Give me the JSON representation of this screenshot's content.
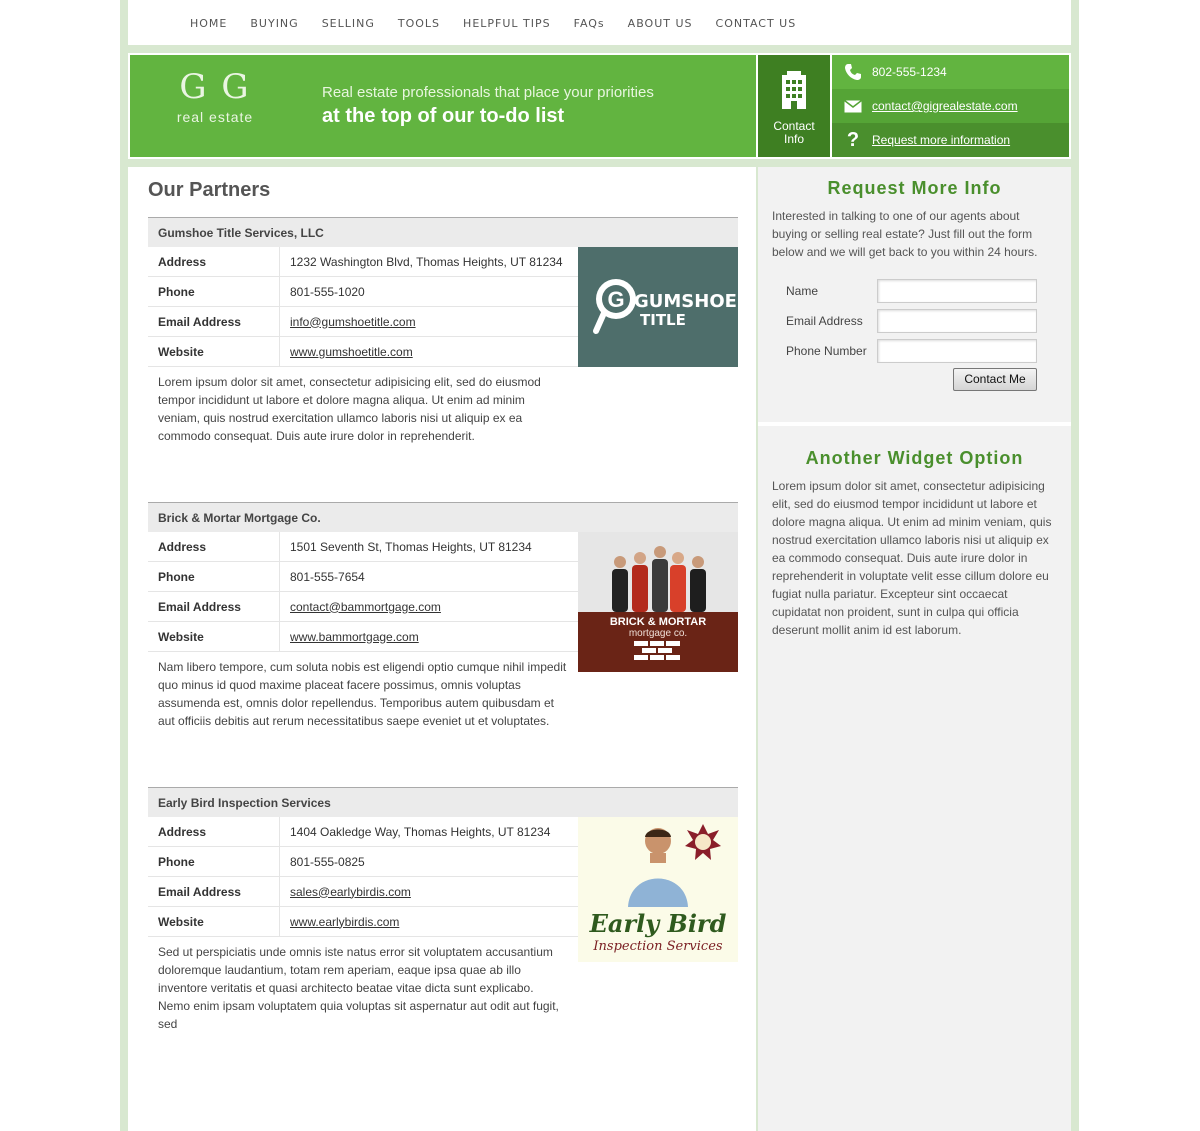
{
  "nav": {
    "items": [
      "HOME",
      "BUYING",
      "SELLING",
      "TOOLS",
      "HELPFUL TIPS",
      "FAQs",
      "ABOUT US",
      "CONTACT US"
    ]
  },
  "banner": {
    "logo_mark": "G G",
    "logo_sub": "real estate",
    "tagline_line1": "Real estate professionals that place your priorities",
    "tagline_line2": "at the top of our to-do list",
    "contact_tile_label": "Contact Info",
    "phone": "802-555-1234",
    "email": "contact@gigrealestate.com",
    "request": "Request more information",
    "colors": {
      "green": "#62b440",
      "dark_green": "#3e7f22"
    }
  },
  "main": {
    "title": "Our Partners",
    "field_labels": {
      "address": "Address",
      "phone": "Phone",
      "email": "Email Address",
      "website": "Website"
    },
    "partners": [
      {
        "name": "Gumshoe Title Services, LLC",
        "address": "1232 Washington Blvd, Thomas Heights, UT 81234",
        "phone": "801-555-1020",
        "email": "info@gumshoetitle.com",
        "website": "www.gumshoetitle.com",
        "description": "Lorem ipsum dolor sit amet, consectetur adipisicing elit, sed do eiusmod tempor incididunt ut labore et dolore magna aliqua. Ut enim ad minim veniam, quis nostrud exercitation ullamco laboris nisi ut aliquip ex ea commodo consequat. Duis aute irure dolor in reprehenderit.",
        "logo_text_1": "GUMSHOE",
        "logo_text_2": "TITLE"
      },
      {
        "name": "Brick & Mortar Mortgage Co.",
        "address": "1501 Seventh St, Thomas Heights, UT 81234",
        "phone": "801-555-7654",
        "email": "contact@bammortgage.com",
        "website": "www.bammortgage.com",
        "description": "Nam libero tempore, cum soluta nobis est eligendi optio cumque nihil impedit quo minus id quod maxime placeat facere possimus, omnis voluptas assumenda est, omnis dolor repellendus. Temporibus autem quibusdam et aut officiis debitis aut rerum necessitatibus saepe eveniet ut et voluptates.",
        "logo_text_1": "BRICK & MORTAR",
        "logo_text_2": "mortgage co."
      },
      {
        "name": "Early Bird Inspection Services",
        "address": "1404 Oakledge Way, Thomas Heights, UT 81234",
        "phone": "801-555-0825",
        "email": "sales@earlybirdis.com",
        "website": "www.earlybirdis.com",
        "description": "Sed ut perspiciatis unde omnis iste natus error sit voluptatem accusantium doloremque laudantium, totam rem aperiam, eaque ipsa quae ab illo inventore veritatis et quasi architecto beatae vitae dicta sunt explicabo. Nemo enim ipsam voluptatem quia voluptas sit aspernatur aut odit aut fugit, sed",
        "logo_text_1": "Early Bird",
        "logo_text_2": "Inspection Services"
      }
    ]
  },
  "sidebar": {
    "request_title": "Request More Info",
    "request_text": "Interested in talking to one of our agents about buying or selling real estate? Just fill out the form below and we will get back to you within 24 hours.",
    "form": {
      "name_label": "Name",
      "email_label": "Email Address",
      "phone_label": "Phone Number",
      "name_value": "",
      "email_value": "",
      "phone_value": "",
      "submit_label": "Contact Me"
    },
    "widget_title": "Another Widget Option",
    "widget_text": "Lorem ipsum dolor sit amet, consectetur adipisicing elit, sed do eiusmod tempor incididunt ut labore et dolore magna aliqua. Ut enim ad minim veniam, quis nostrud exercitation ullamco laboris nisi ut aliquip ex ea commodo consequat. Duis aute irure dolor in reprehenderit in voluptate velit esse cillum dolore eu fugiat nulla pariatur. Excepteur sint occaecat cupidatat non proident, sunt in culpa qui officia deserunt mollit anim id est laborum."
  }
}
